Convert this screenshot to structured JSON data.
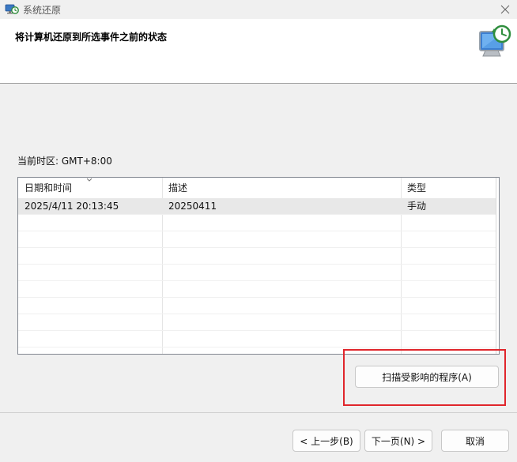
{
  "window": {
    "title": "系统还原"
  },
  "header": {
    "title": "将计算机还原到所选事件之前的状态",
    "icon": "system-restore-icon"
  },
  "timezone_label": "当前时区: GMT+8:00",
  "table": {
    "columns": [
      "日期和时间",
      "描述",
      "类型"
    ],
    "rows": [
      {
        "datetime": "2025/4/11 20:13:45",
        "description": "20250411",
        "type": "手动"
      }
    ]
  },
  "buttons": {
    "scan": "扫描受影响的程序(A)",
    "back": "< 上一步(B)",
    "next": "下一页(N) >",
    "cancel": "取消"
  },
  "colors": {
    "highlight": "#e0262c",
    "selected_row": "#e8e8e8"
  }
}
